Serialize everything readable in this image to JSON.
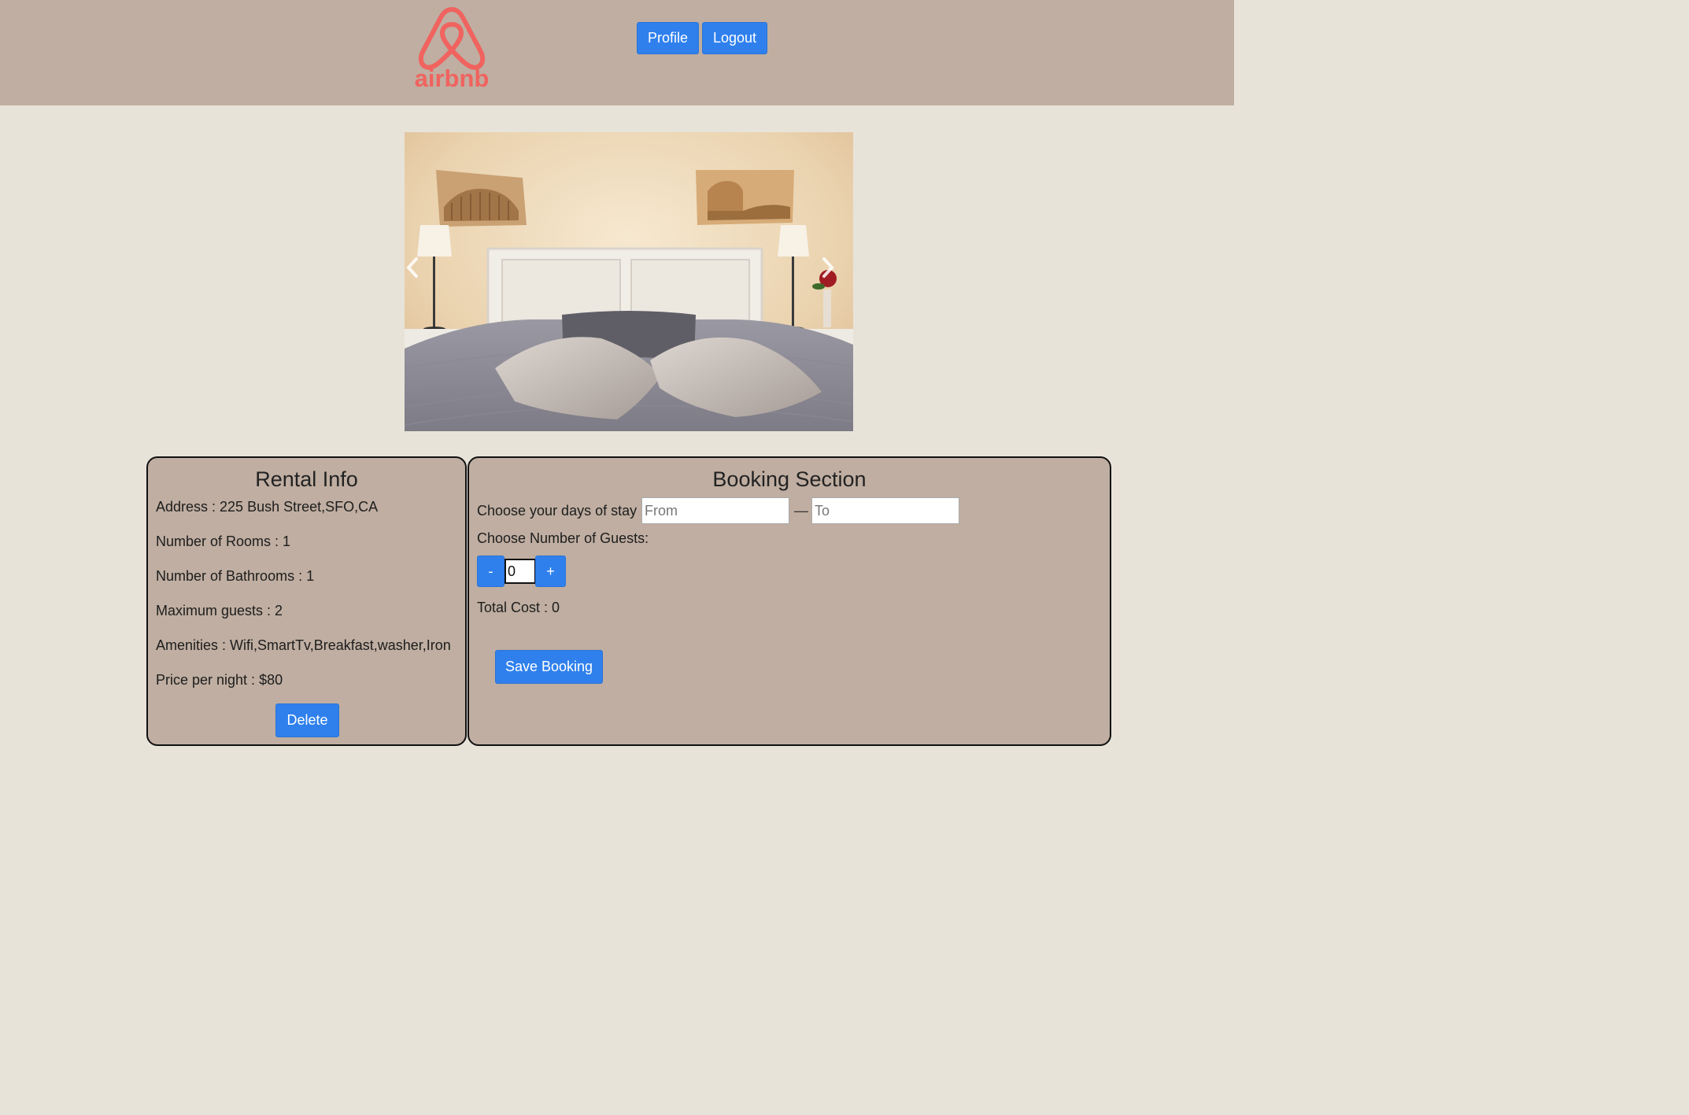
{
  "header": {
    "logo_text": "airbnb",
    "nav": {
      "profile_label": "Profile",
      "logout_label": "Logout"
    },
    "brand_color": "#ff5a5f"
  },
  "carousel": {
    "prev_icon": "chevron-left-icon",
    "next_icon": "chevron-right-icon"
  },
  "rental_info": {
    "title": "Rental Info",
    "address": "Address : 225 Bush Street,SFO,CA",
    "rooms": "Number of Rooms : 1",
    "bathrooms": "Number of Bathrooms : 1",
    "max_guests": "Maximum guests : 2",
    "amenities": "Amenities : Wifi,SmartTv,Breakfast,washer,Iron",
    "price": "Price per night : $80",
    "delete_label": "Delete"
  },
  "booking": {
    "title": "Booking Section",
    "days_label": "Choose your days of stay :",
    "from_placeholder": "From",
    "to_placeholder": "To",
    "dash": "—",
    "guests_label": "Choose Number of Guests:",
    "minus_label": "-",
    "plus_label": "+",
    "guest_count": "0",
    "total_cost": "Total Cost : 0",
    "save_label": "Save Booking"
  },
  "colors": {
    "header_bg": "#bfaea1",
    "page_bg": "#e8e3d9",
    "button_blue": "#2f80ed"
  }
}
